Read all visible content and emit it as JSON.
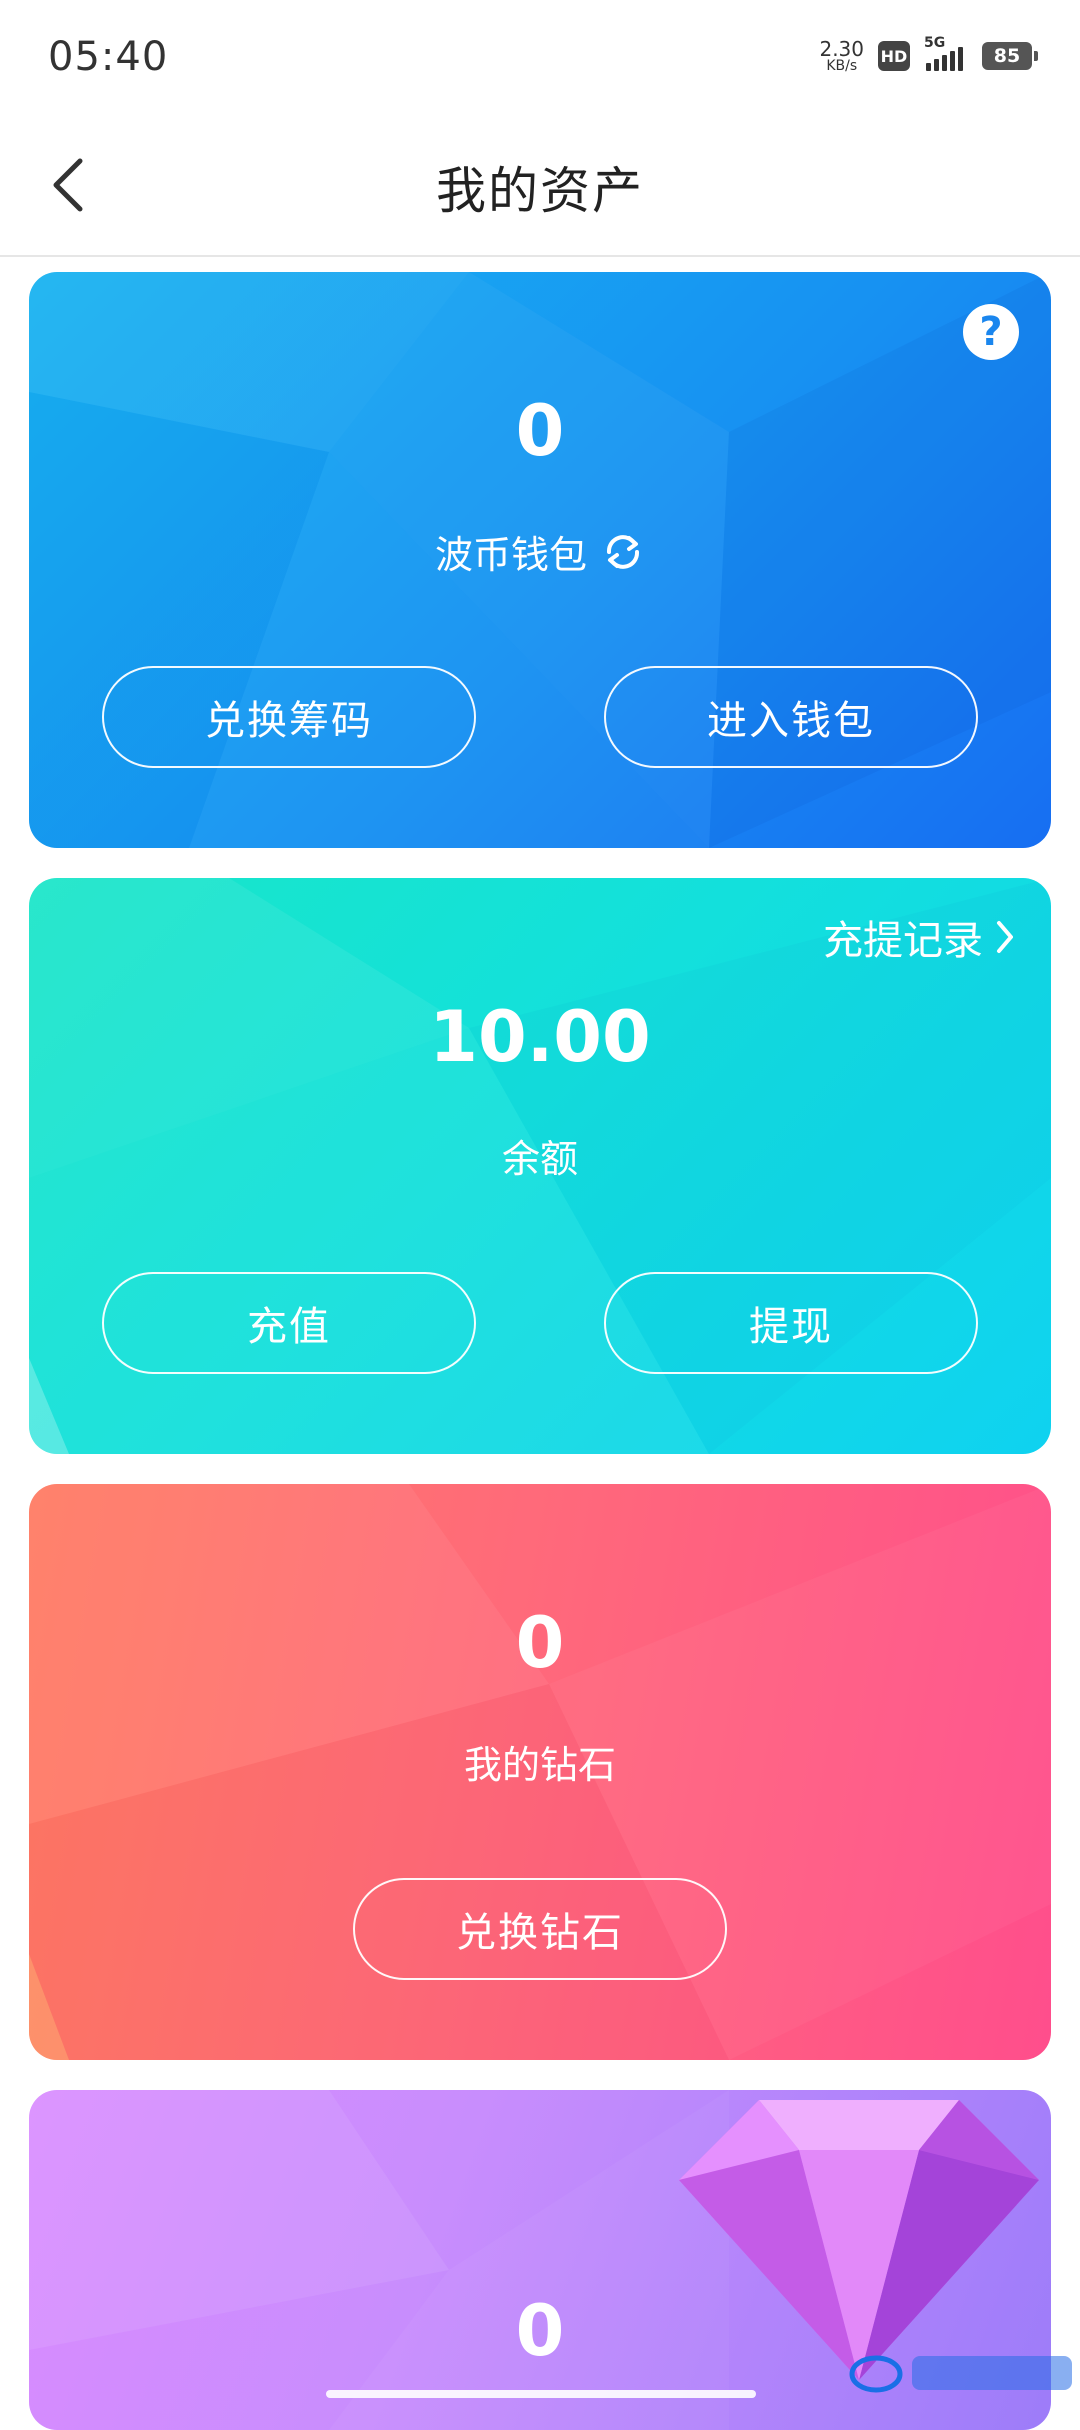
{
  "status_bar": {
    "time": "05:40",
    "net_speed_value": "2.30",
    "net_speed_unit": "KB/s",
    "hd_label": "HD",
    "network_type": "5G",
    "battery": "85"
  },
  "header": {
    "title": "我的资产",
    "back_icon": "chevron-left-icon"
  },
  "cards": {
    "wallet": {
      "value": "0",
      "label": "波币钱包",
      "exchange_button": "兑换筹码",
      "enter_button": "进入钱包",
      "help_icon": "?",
      "refresh_icon": "refresh-icon",
      "colors": [
        "#18b3f1",
        "#176ef2"
      ]
    },
    "balance": {
      "value": "10.00",
      "label": "余额",
      "records_link": "充提记录",
      "recharge_button": "充值",
      "withdraw_button": "提现",
      "colors": [
        "#19e6c8",
        "#0fd2f0"
      ]
    },
    "diamond": {
      "value": "0",
      "label": "我的钻石",
      "exchange_button": "兑换钻石",
      "colors": [
        "#ff7b62",
        "#ff4e8c"
      ]
    },
    "gem": {
      "value": "0",
      "colors": [
        "#d98cff",
        "#9d7cf9"
      ]
    }
  }
}
